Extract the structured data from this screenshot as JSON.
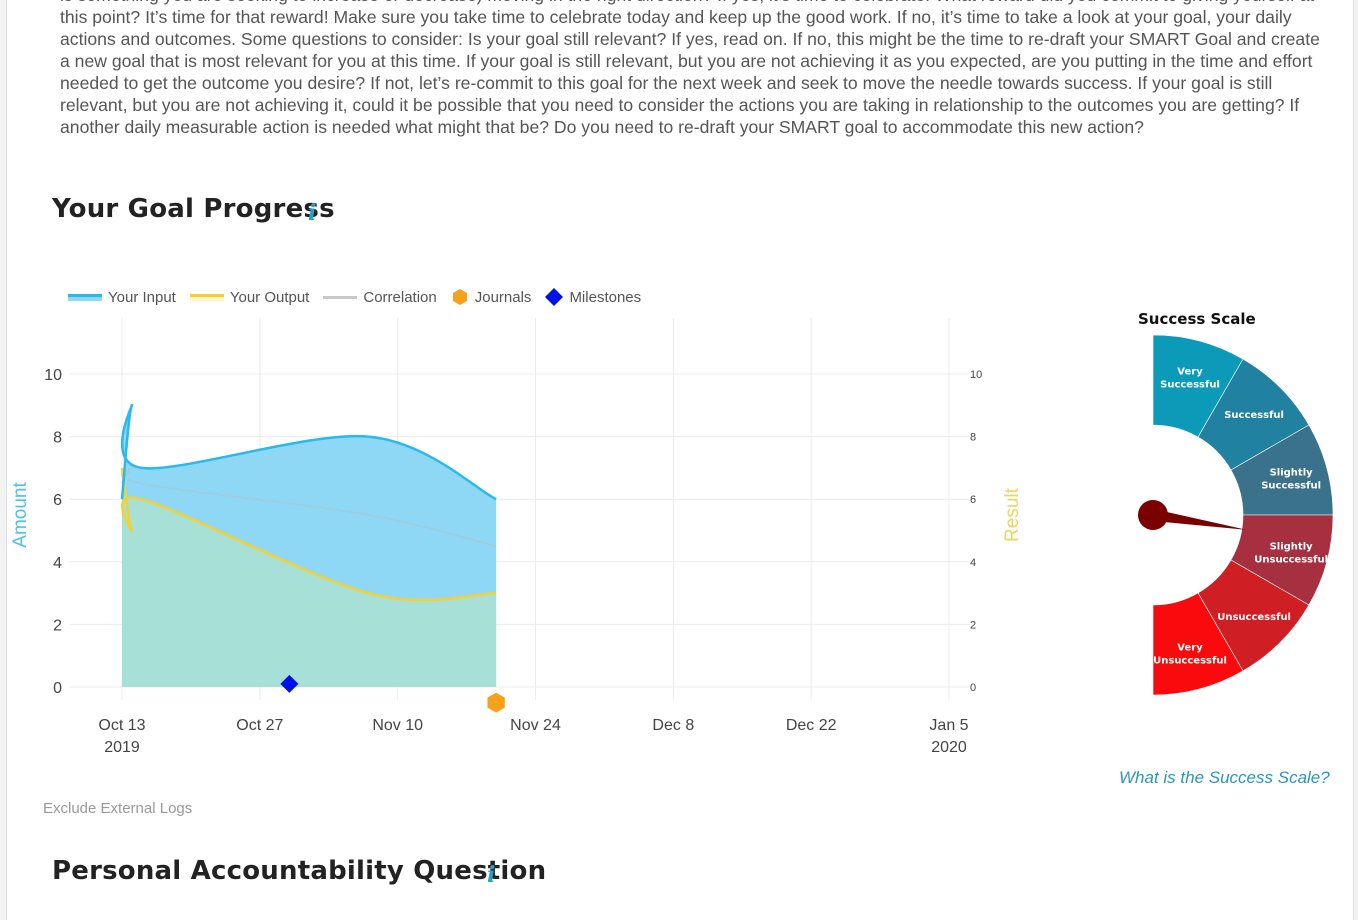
{
  "intro": {
    "text": "is something you are seeking to increase or decrease) moving in the right direction? If yes, it’s time to celebrate. What reward did you commit to giving yourself at this point? It’s time for that reward! Make sure you take time to celebrate today and keep up the good work. If no, it’s time to take a look at your goal, your daily actions and outcomes. Some questions to consider: Is your goal still relevant? If yes, read on. If no, this might be the time to re-draft your SMART Goal and create a new goal that is most relevant for you at this time. If your goal is still relevant, but you are not achieving it as you expected, are you putting in the time and effort needed to get the outcome you desire? If not, let’s re-commit to this goal for the next week and seek to move the needle towards success. If your goal is still relevant, but you are not achieving it, could it be possible that you need to consider the actions you are taking in relationship to the outcomes you are getting? If another daily measurable action is needed what might that be? Do you need to re-draft your SMART goal to accommodate this new action?"
  },
  "goal_progress": {
    "title": "Your Goal Progress",
    "info_icon": "i"
  },
  "legend": {
    "input": "Your Input",
    "output": "Your Output",
    "correlation": "Correlation",
    "journals": "Journals",
    "milestones": "Milestones"
  },
  "colors": {
    "input_line": "#29b9ea",
    "input_fill": "#8ed8f6",
    "output_line": "#f5d033",
    "overlap_fill": "#a7e0d6",
    "correlation": "#9ccde0",
    "journal": "#f7a11a",
    "milestone": "#0010e8"
  },
  "chart_data": {
    "type": "area",
    "x_ticks": [
      {
        "label": "Oct 13",
        "year": "2019",
        "date": "2019-10-13"
      },
      {
        "label": "Oct 27",
        "year": "",
        "date": "2019-10-27"
      },
      {
        "label": "Nov 10",
        "year": "",
        "date": "2019-11-10"
      },
      {
        "label": "Nov 24",
        "year": "",
        "date": "2019-11-24"
      },
      {
        "label": "Dec 8",
        "year": "",
        "date": "2019-12-08"
      },
      {
        "label": "Dec 22",
        "year": "",
        "date": "2019-12-22"
      },
      {
        "label": "Jan 5",
        "year": "2020",
        "date": "2020-01-05"
      }
    ],
    "xlim": [
      "2019-10-12",
      "2020-01-05"
    ],
    "ylabel_left": "Amount",
    "ylabel_right": "Result",
    "ylim": [
      0,
      10
    ],
    "y_ticks": [
      0,
      2,
      4,
      6,
      8,
      10
    ],
    "series": [
      {
        "name": "Your Input",
        "points": [
          [
            "2019-10-13",
            6
          ],
          [
            "2019-10-14",
            9
          ],
          [
            "2019-10-15",
            7
          ],
          [
            "2019-11-07",
            8
          ],
          [
            "2019-11-20",
            6
          ]
        ]
      },
      {
        "name": "Your Output",
        "points": [
          [
            "2019-10-13",
            7
          ],
          [
            "2019-10-14",
            5
          ],
          [
            "2019-10-15",
            6
          ],
          [
            "2019-11-07",
            3
          ],
          [
            "2019-11-20",
            3
          ]
        ]
      },
      {
        "name": "Correlation",
        "points": [
          [
            "2019-10-13",
            6.5
          ],
          [
            "2019-10-14",
            7
          ],
          [
            "2019-10-15",
            6.5
          ],
          [
            "2019-11-07",
            5.5
          ],
          [
            "2019-11-20",
            4.5
          ]
        ]
      }
    ],
    "journals": [
      {
        "date": "2019-11-20",
        "y": -0.5
      }
    ],
    "milestones": [
      {
        "date": "2019-10-30",
        "y": 0.1
      }
    ],
    "grid": true,
    "legend": "top-left"
  },
  "gauge": {
    "title": "Success Scale",
    "segments": [
      {
        "label": [
          "Very",
          "Successful"
        ],
        "color": "#0b9bb9"
      },
      {
        "label": [
          "Successful"
        ],
        "color": "#2181a0"
      },
      {
        "label": [
          "Slightly",
          "Successful"
        ],
        "color": "#3a728c"
      },
      {
        "label": [
          "Slightly",
          "Unsuccessful"
        ],
        "color": "#a6303f"
      },
      {
        "label": [
          "Unsuccessful"
        ],
        "color": "#cf1f24"
      },
      {
        "label": [
          "Very",
          "Unsuccessful"
        ],
        "color": "#fa0a0d"
      }
    ],
    "needle_value": 0.55,
    "needle_color": "#7a0000",
    "link": "What is the Success Scale?"
  },
  "footer": {
    "exclude_label": "Exclude External Logs",
    "next_section": "Personal Accountability Question",
    "info_icon": "i"
  }
}
